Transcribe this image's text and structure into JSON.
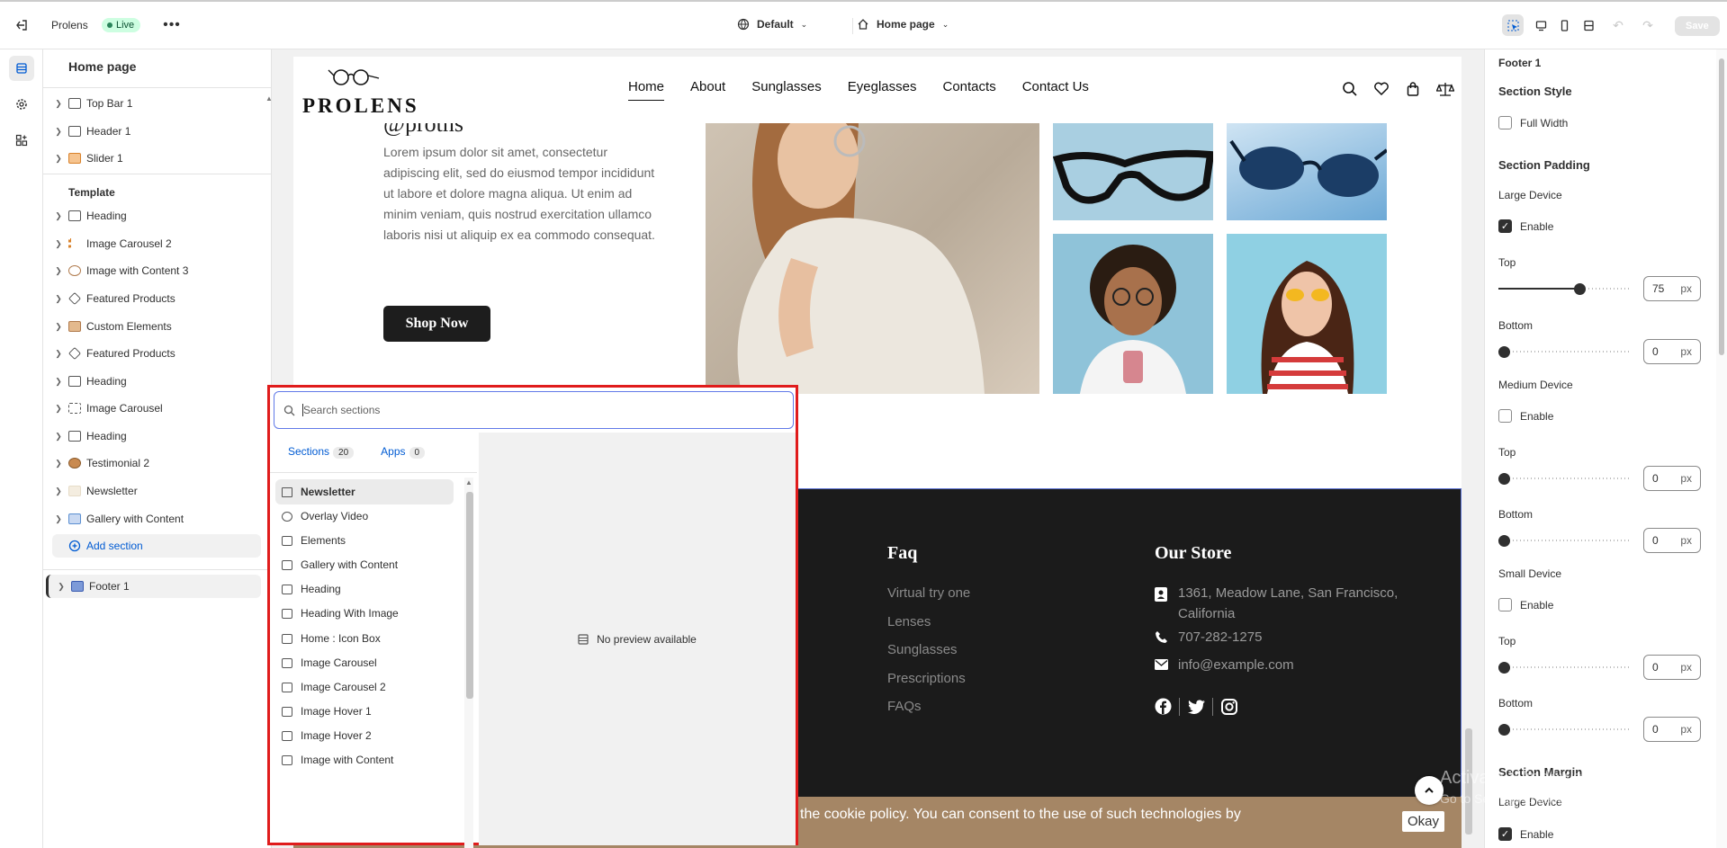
{
  "topbar": {
    "store_name": "Prolens",
    "live_badge": "Live",
    "theme_select": "Default",
    "page_select": "Home page",
    "save_label": "Save"
  },
  "sidebar": {
    "title": "Home page",
    "header_items": [
      {
        "label": "Top Bar 1",
        "icon": "section-icon"
      },
      {
        "label": "Header 1",
        "icon": "section-icon"
      },
      {
        "label": "Slider 1",
        "icon": "image-icon"
      }
    ],
    "template_label": "Template",
    "template_items": [
      {
        "label": "Heading",
        "icon": "section-icon"
      },
      {
        "label": "Image Carousel 2",
        "icon": "image-icon"
      },
      {
        "label": "Image with Content 3",
        "icon": "image-icon"
      },
      {
        "label": "Featured Products",
        "icon": "tag-icon"
      },
      {
        "label": "Custom Elements",
        "icon": "image-icon"
      },
      {
        "label": "Featured Products",
        "icon": "tag-icon"
      },
      {
        "label": "Heading",
        "icon": "section-icon"
      },
      {
        "label": "Image Carousel",
        "icon": "image-icon"
      },
      {
        "label": "Heading",
        "icon": "section-icon"
      },
      {
        "label": "Testimonial 2",
        "icon": "image-icon"
      },
      {
        "label": "Newsletter",
        "icon": "image-icon"
      },
      {
        "label": "Gallery with Content",
        "icon": "image-icon"
      }
    ],
    "add_section": "Add section",
    "footer_item": "Footer 1"
  },
  "site": {
    "logo": "PROLENS",
    "nav": [
      "Home",
      "About",
      "Sunglasses",
      "Eyeglasses",
      "Contacts",
      "Contact Us"
    ],
    "hero_text": "Lorem ipsum dolor sit amet, consectetur adipiscing elit, sed do eiusmod tempor incididunt ut labore et dolore magna aliqua. Ut enim ad minim veniam, quis nostrud exercitation ullamco laboris nisi ut aliquip ex ea commodo consequat.",
    "shop_button": "Shop Now",
    "footer": {
      "faq_heading": "Faq",
      "faq_links": [
        "Virtual try one",
        "Lenses",
        "Sunglasses",
        "Prescriptions",
        "FAQs"
      ],
      "store_heading": "Our Store",
      "address": "1361, Meadow Lane, San Francisco, California",
      "phone": "707-282-1275",
      "email": "info@example.com"
    },
    "cookie_text": "the cookie policy. You can consent to the use of such technologies by",
    "okay_button": "Okay"
  },
  "picker": {
    "search_placeholder": "Search sections",
    "tab_sections": "Sections",
    "sections_count": "20",
    "tab_apps": "Apps",
    "apps_count": "0",
    "items": [
      "Newsletter",
      "Overlay Video",
      "Elements",
      "Gallery with Content",
      "Heading",
      "Heading With Image",
      "Home : Icon Box",
      "Image Carousel",
      "Image Carousel 2",
      "Image Hover 1",
      "Image Hover 2",
      "Image with Content"
    ],
    "selected_item": "Newsletter",
    "preview_text": "No preview available"
  },
  "settings": {
    "title": "Footer 1",
    "section_style": "Section Style",
    "full_width": {
      "label": "Full Width",
      "checked": false
    },
    "section_padding": "Section Padding",
    "large_device": "Large Device",
    "enable_label": "Enable",
    "large_enable": true,
    "medium_device": "Medium Device",
    "medium_enable": false,
    "small_device": "Small Device",
    "small_enable": false,
    "top_label": "Top",
    "bottom_label": "Bottom",
    "unit": "px",
    "large_top": "75",
    "large_bottom": "0",
    "medium_top": "0",
    "medium_bottom": "0",
    "small_top": "0",
    "small_bottom": "0",
    "slider_max": 120,
    "section_margin": "Section Margin",
    "margin_large_device": "Large Device",
    "margin_large_enable": true
  },
  "watermark": {
    "title": "Activate Windows",
    "subtitle": "Go to Settings to activate Windows."
  },
  "colors": {
    "accent": "#005bd3",
    "picker_border": "#e01c1c",
    "footer_bg": "#1b1b1b",
    "cookie_bg": "#a58665"
  }
}
